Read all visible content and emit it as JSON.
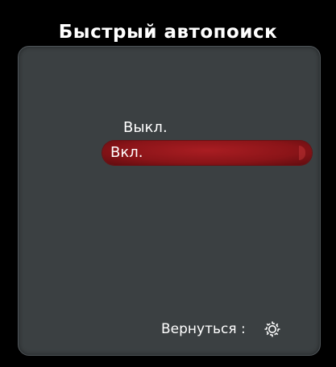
{
  "osd": {
    "title": "Быстрый автопоиск",
    "options": [
      {
        "label": "Выкл.",
        "selected": false
      },
      {
        "label": "Вкл.",
        "selected": true
      }
    ],
    "footer": {
      "back_label": "Вернуться :",
      "icon": "gear-icon"
    }
  },
  "colors": {
    "background": "#000000",
    "panel": "#3b4042",
    "highlight": "#9c1a1e",
    "text": "#ffffff"
  }
}
